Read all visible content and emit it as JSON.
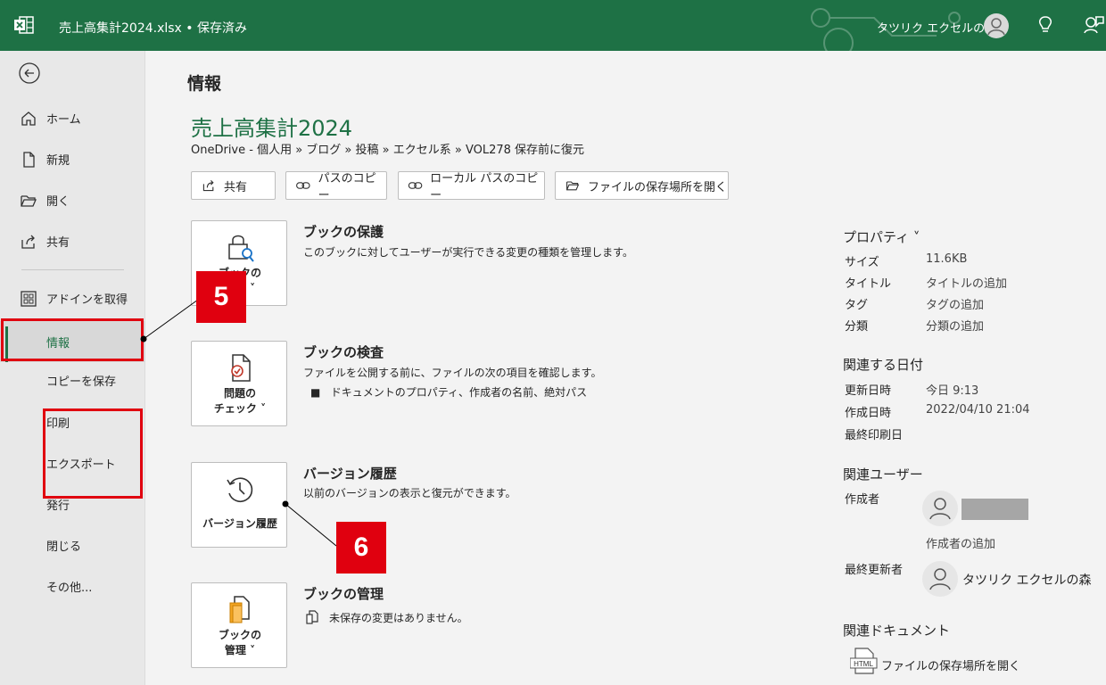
{
  "titlebar": {
    "doc_title": "売上高集計2024.xlsx • 保存済み",
    "user_name": "タツリク エクセルの森"
  },
  "nav": {
    "items": [
      {
        "label": "ホーム"
      },
      {
        "label": "新規"
      },
      {
        "label": "開く"
      },
      {
        "label": "共有"
      },
      {
        "label": "アドインを取得"
      },
      {
        "label": "情報"
      },
      {
        "label": "コピーを保存"
      },
      {
        "label": "印刷"
      },
      {
        "label": "エクスポート"
      },
      {
        "label": "発行"
      },
      {
        "label": "閉じる"
      },
      {
        "label": "その他..."
      }
    ],
    "active": "情報"
  },
  "main": {
    "page_title": "情報",
    "book_name": "売上高集計2024",
    "breadcrumb": "OneDrive - 個人用 » ブログ » 投稿 » エクセル系 » VOL278 保存前に復元",
    "buttons": {
      "share": "共有",
      "copy_path": "パスのコピー",
      "copy_local_path": "ローカル パスのコピー",
      "open_location": "ファイルの保存場所を開く"
    },
    "sections": {
      "protect": {
        "btn_line1": "ブックの",
        "btn_line2": "保護 ˅",
        "title": "ブックの保護",
        "desc": "このブックに対してユーザーが実行できる変更の種類を管理します。"
      },
      "inspect": {
        "btn_line1": "問題の",
        "btn_line2": "チェック ˅",
        "title": "ブックの検査",
        "desc": "ファイルを公開する前に、ファイルの次の項目を確認します。",
        "bullet": "ドキュメントのプロパティ、作成者の名前、絶対パス"
      },
      "version": {
        "btn_label": "バージョン履歴",
        "title": "バージョン履歴",
        "desc": "以前のバージョンの表示と復元ができます。"
      },
      "manage": {
        "btn_line1": "ブックの",
        "btn_line2": "管理 ˅",
        "title": "ブックの管理",
        "desc": "未保存の変更はありません。"
      }
    }
  },
  "properties": {
    "heading": "プロパティ ˅",
    "rows": [
      {
        "key": "サイズ",
        "value": "11.6KB"
      },
      {
        "key": "タイトル",
        "value": "タイトルの追加"
      },
      {
        "key": "タグ",
        "value": "タグの追加"
      },
      {
        "key": "分類",
        "value": "分類の追加"
      }
    ],
    "dates_heading": "関連する日付",
    "dates": [
      {
        "key": "更新日時",
        "value": "今日 9:13"
      },
      {
        "key": "作成日時",
        "value": "2022/04/10 21:04"
      },
      {
        "key": "最終印刷日",
        "value": ""
      }
    ],
    "people_heading": "関連ユーザー",
    "author_label": "作成者",
    "add_author": "作成者の追加",
    "last_modified_label": "最終更新者",
    "last_modified_name": "タツリク エクセルの森",
    "docs_heading": "関連ドキュメント",
    "open_location": "ファイルの保存場所を開く"
  },
  "callouts": {
    "five": "5",
    "six": "6"
  },
  "colors": {
    "excel_green": "#1e7145",
    "highlight_red": "#e0000f"
  }
}
